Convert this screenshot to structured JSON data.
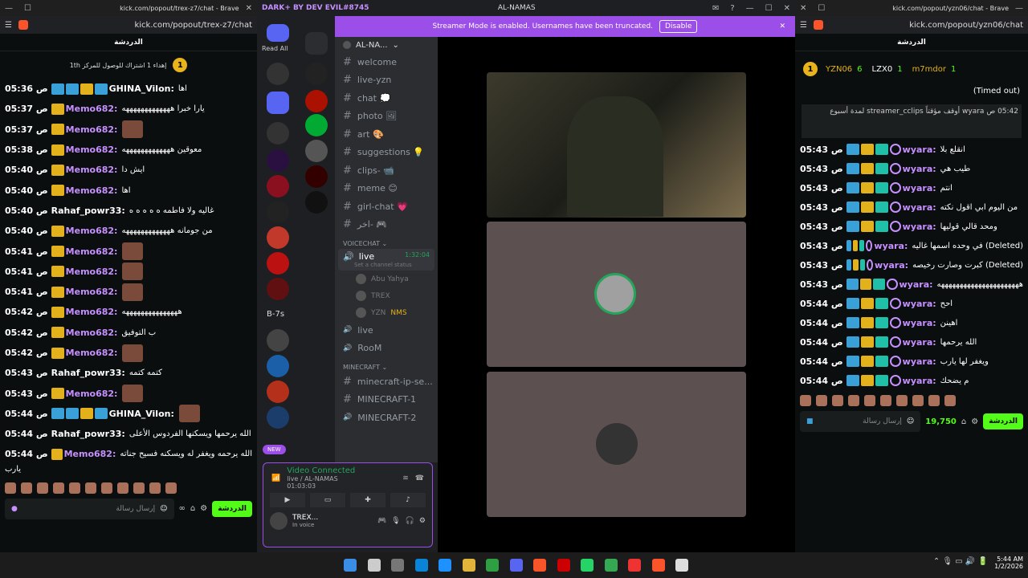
{
  "left": {
    "title": "kick.com/popout/trex-z7/chat - Brave",
    "url": "kick.com/popout/trex-z7/chat",
    "header": "الدردشة",
    "pinned_rank": "1",
    "pinned_text": "إهداء 1 اشتراك للوصول للمركز 1th",
    "messages": [
      {
        "t": "05:36 ص",
        "u": "GHINA_Vilon:",
        "c": "#fff",
        "m": "اها",
        "badges": "bbyb"
      },
      {
        "t": "05:37 ص",
        "u": "Memo682:",
        "c": "#c690ff",
        "m": "يارا خبرا هههههههههههههه",
        "badges": "y"
      },
      {
        "t": "05:37 ص",
        "u": "Memo682:",
        "c": "#c690ff",
        "m": "",
        "badges": "y",
        "img": true
      },
      {
        "t": "05:38 ص",
        "u": "Memo682:",
        "c": "#c690ff",
        "m": "معوقين هههههههههههههه",
        "badges": "y"
      },
      {
        "t": "05:40 ص",
        "u": "Memo682:",
        "c": "#c690ff",
        "m": "ايش دا",
        "badges": "y"
      },
      {
        "t": "05:40 ص",
        "u": "Memo682:",
        "c": "#c690ff",
        "m": "اها",
        "badges": "y"
      },
      {
        "t": "05:40 ص",
        "u": "Rahaf_powr33:",
        "c": "#fff",
        "m": "غاليه ولا فاطمه ه ه ه ه ه",
        "badges": ""
      },
      {
        "t": "05:40 ص",
        "u": "Memo682:",
        "c": "#c690ff",
        "m": "من جومانه هههههههههههههه",
        "badges": "y"
      },
      {
        "t": "05:41 ص",
        "u": "Memo682:",
        "c": "#c690ff",
        "m": "",
        "badges": "y",
        "img": true
      },
      {
        "t": "05:41 ص",
        "u": "Memo682:",
        "c": "#c690ff",
        "m": "",
        "badges": "y",
        "img": true
      },
      {
        "t": "05:41 ص",
        "u": "Memo682:",
        "c": "#c690ff",
        "m": "",
        "badges": "y",
        "img": true
      },
      {
        "t": "05:42 ص",
        "u": "Memo682:",
        "c": "#c690ff",
        "m": "هههههههههههههههه",
        "badges": "y"
      },
      {
        "t": "05:42 ص",
        "u": "Memo682:",
        "c": "#c690ff",
        "m": "ب التوفيق",
        "badges": "y"
      },
      {
        "t": "05:42 ص",
        "u": "Memo682:",
        "c": "#c690ff",
        "m": "",
        "badges": "y",
        "img": true
      },
      {
        "t": "05:43 ص",
        "u": "Rahaf_powr33:",
        "c": "#fff",
        "m": "كتمه كتمه",
        "badges": ""
      },
      {
        "t": "05:43 ص",
        "u": "Memo682:",
        "c": "#c690ff",
        "m": "",
        "badges": "y",
        "img": true
      },
      {
        "t": "05:44 ص",
        "u": "GHINA_Vilon:",
        "c": "#fff",
        "m": "",
        "badges": "bbyb",
        "img": true
      },
      {
        "t": "05:44 ص",
        "u": "Rahaf_powr33:",
        "c": "#fff",
        "m": "الله يرحمها ويسكنها الفردوس الأعلى",
        "badges": ""
      },
      {
        "t": "05:44 ص",
        "u": "Memo682:",
        "c": "#c690ff",
        "m": "الله يرحمه ويغفر له ويسكنه فسيح جناته",
        "badges": "y"
      }
    ],
    "wrap": "يارب",
    "input_placeholder": "إرسال رسالة",
    "chat_button": "الدردشة"
  },
  "discord": {
    "title": "DARK+ BY DEV EVIL#8745",
    "server": "AL-NAMAS",
    "read_all": "Read All",
    "banner": "Streamer Mode is enabled. Usernames have been truncated.",
    "disable": "Disable",
    "server_short": "AL-NA...",
    "channels": [
      "welcome",
      "live-yzn",
      "chat 💭",
      "photo 🖼",
      "art 🎨",
      "suggestions 💡",
      "clips- 📹",
      "meme 😊",
      "girl-chat 💗",
      "اخر- 🎮"
    ],
    "voice_cat": "VOICECHAT",
    "live": "live",
    "live_time": "1:32:04",
    "status_hint": "Set a channel status",
    "voice_users": [
      "Abu Yahya",
      "TREX",
      "YZN"
    ],
    "nms": "NMS",
    "voice2": [
      "live",
      "RooM"
    ],
    "mc_cat": "MINECRAFT",
    "mc": [
      "minecraft-ip-se...",
      "MINECRAFT-1",
      "MINECRAFT-2"
    ],
    "new": "NEW",
    "server_ab": "B-7s",
    "vc_title": "Video Connected",
    "vc_sub": "live / AL-NAMAS",
    "vc_time": "01:03:03",
    "me": "TREX...",
    "me_status": "In voice",
    "accent": "#9b4ee8"
  },
  "right": {
    "title": "kick.com/popout/yzn06/chat - Brave",
    "url": "kick.com/popout/yzn06/chat",
    "header": "الدردشة",
    "top": [
      {
        "u": "YZN06",
        "n": "6"
      },
      {
        "u": "LZX0",
        "n": "1"
      },
      {
        "u": "m7mdor",
        "n": "1"
      }
    ],
    "timed_out": "(Timed out)",
    "mod_line": "05:42 ص wyara أوقف مؤقتاً streamer_cclips لمدة أسبوع",
    "messages": [
      {
        "t": "05:43 ص",
        "m": "انقلع بلا"
      },
      {
        "t": "05:43 ص",
        "m": "طيب هي"
      },
      {
        "t": "05:43 ص",
        "m": "انتم"
      },
      {
        "t": "05:43 ص",
        "m": "من اليوم ابي اقول نكته"
      },
      {
        "t": "05:43 ص",
        "m": "ومحد قالي قوليها"
      },
      {
        "t": "05:43 ص",
        "m": "في وحده اسمها غاليه (Deleted)"
      },
      {
        "t": "05:43 ص",
        "m": "كبرت وصارت رخيصه (Deleted)"
      },
      {
        "t": "05:43 ص",
        "m": "ههههههههههههههههههههههه"
      },
      {
        "t": "05:44 ص",
        "m": "احح"
      },
      {
        "t": "05:44 ص",
        "m": "اهينن"
      },
      {
        "t": "05:44 ص",
        "m": "الله يرحمها"
      },
      {
        "t": "05:44 ص",
        "m": "ويغفر لها يارب"
      },
      {
        "t": "05:44 ص",
        "m": "م يضحك"
      }
    ],
    "user": "wyara:",
    "input_placeholder": "إرسال رسالة",
    "points": "19,750",
    "chat_button": "الدردشة"
  },
  "taskbar": {
    "time": "5:44 AM",
    "date": "1/2/2026"
  }
}
